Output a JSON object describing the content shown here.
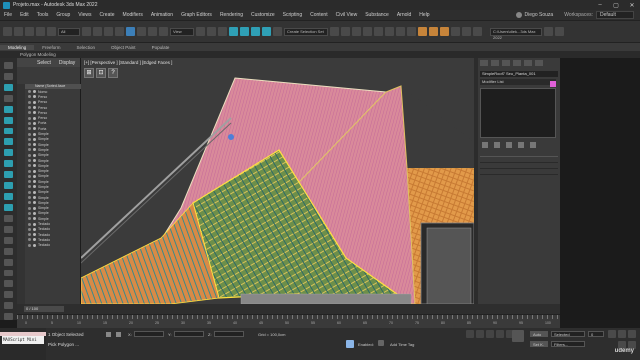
{
  "window": {
    "title": "Projeto.max - Autodesk 3ds Max 2022",
    "controls": [
      "–",
      "▢",
      "✕"
    ]
  },
  "menu": {
    "items": [
      "File",
      "Edit",
      "Tools",
      "Group",
      "Views",
      "Create",
      "Modifiers",
      "Animation",
      "Graph Editors",
      "Rendering",
      "Customize",
      "Scripting",
      "Content",
      "Civil View",
      "Substance",
      "Arnold",
      "Help"
    ],
    "user_name": "Diego Souza",
    "workspaces_label": "Workspaces:",
    "workspace_value": "Default"
  },
  "toolbar": {
    "filter_dropdown": "All",
    "view_dropdown": "View",
    "selection_set_dropdown": "Create Selection Set",
    "path_dropdown": "C:\\Users\\diek...3ds Max 2022"
  },
  "ribbon": {
    "tabs": [
      "Modeling",
      "Freeform",
      "Selection",
      "Object Paint",
      "Populate"
    ],
    "sub_label": "Polygon Modeling"
  },
  "explorer": {
    "tabs": [
      "Select",
      "Display"
    ],
    "column_header": "Name (Sorted Asce",
    "rows": [
      "Nomo",
      "Perso",
      "Perso",
      "Perso",
      "Perso",
      "Perso",
      "Porta",
      "Porta",
      "Simple",
      "Simple",
      "Simple",
      "Simple",
      "Simple",
      "Simple",
      "Simple",
      "Simple",
      "Simple",
      "Simple",
      "Simple",
      "Simple",
      "Simple",
      "Simple",
      "Simple",
      "Simple",
      "Simple",
      "Teclado",
      "Teclado",
      "Teclado",
      "Teclado",
      "Teclado"
    ]
  },
  "viewport": {
    "label": "[+] [Perspective ] [Standard ] [Edged Faces ]"
  },
  "command_panel": {
    "object_name": "SimpleRoof7 Seu_Planta_001",
    "modifier_list": "Modifier List",
    "object_color": "#e060d8"
  },
  "timeline": {
    "counter": "0 / 100",
    "ticks": [
      "0",
      "5",
      "10",
      "15",
      "20",
      "25",
      "30",
      "35",
      "40",
      "45",
      "50",
      "55",
      "60",
      "65",
      "70",
      "75",
      "80",
      "85",
      "90",
      "95",
      "100"
    ]
  },
  "status": {
    "maxscript": "MAXScript Mini",
    "objects_selected": "1 Object Selected",
    "prompt": "Pick Polygon ...",
    "x_label": "X:",
    "y_label": "Y:",
    "z_label": "Z:",
    "grid": "Grid = 100,0cm",
    "enabled_label": "Enabled:",
    "add_time_tag": "Add Time Tag",
    "auto_label": "Auto",
    "set_key_label": "Set K.",
    "selected_option": "Selected",
    "key_filters": "Filters...",
    "frame_value": "0"
  },
  "watermark": "udemy"
}
